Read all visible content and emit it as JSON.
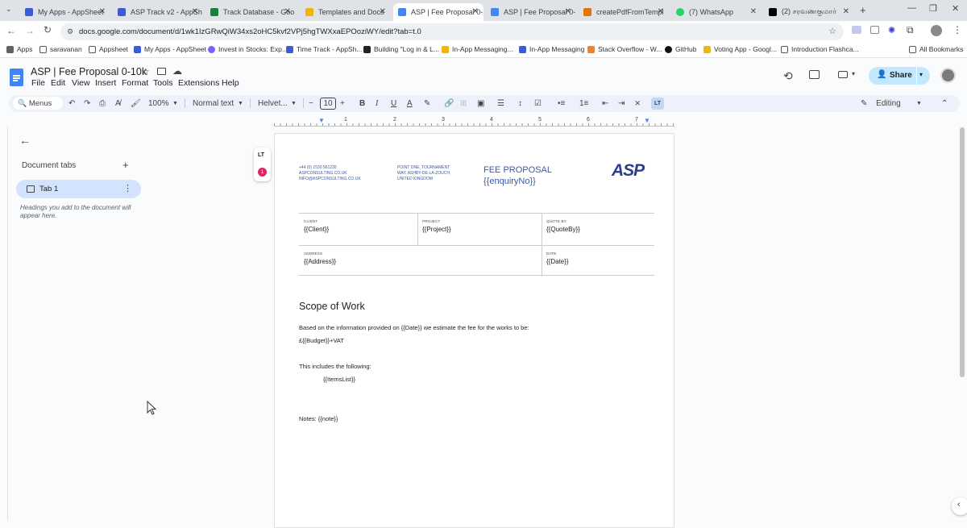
{
  "tabs": [
    {
      "title": "My Apps - AppSheet",
      "color": "#3b5bdb"
    },
    {
      "title": "ASP Track v2 - AppSh",
      "color": "#3b5bdb"
    },
    {
      "title": "Track Database - Goo",
      "color": "#188038"
    },
    {
      "title": "Templates and Docs",
      "color": "#f4b400"
    },
    {
      "title": "ASP | Fee Proposal 0-",
      "color": "#4285f4"
    },
    {
      "title": "ASP | Fee Proposal 0-",
      "color": "#4285f4"
    },
    {
      "title": "createPdfFromTempl",
      "color": "#e37400"
    },
    {
      "title": "(7) WhatsApp",
      "color": "#25d366"
    },
    {
      "title": "(2) சரவணகுமார்",
      "color": "#000000"
    }
  ],
  "url": "docs.google.com/document/d/1wk1IzGRwQiW34xs2oHC5kvf2VPj5hgTWXxaEPOoziWY/edit?tab=t.0",
  "bookmarks": [
    "Apps",
    "saravanan",
    "Appsheet",
    "My Apps - AppSheet",
    "Invest in Stocks: Exp...",
    "Time Track - AppSh...",
    "Building \"Log in & L...",
    "In-App Messaging...",
    "In-App Messaging",
    "Stack Overflow - W...",
    "GitHub",
    "Voting App - Googl...",
    "Introduction Flashca...",
    "All Bookmarks"
  ],
  "doc": {
    "title": "ASP | Fee Proposal 0-10k",
    "menus": [
      "File",
      "Edit",
      "View",
      "Insert",
      "Format",
      "Tools",
      "Extensions",
      "Help"
    ],
    "share": "Share"
  },
  "toolbar": {
    "menus_search": "Menus",
    "zoom": "100%",
    "style": "Normal text",
    "font": "Helvet...",
    "size": "10",
    "mode": "Editing"
  },
  "sidebar": {
    "heading": "Document tabs",
    "tab_label": "Tab 1",
    "hint": "Headings you add to the document will appear here."
  },
  "badge_count": "1",
  "letterhead": {
    "phone": "+44 (0) 1530 561230",
    "web": "ASPCONSULTING.CO.UK",
    "email": "INFO@ASPCONSULTING.CO.UK",
    "addr1": "POINT ONE, TOURNAMENT",
    "addr2": "WAY, ASHBY-DE-LA-ZOUCH,",
    "addr3": "UNITED KINGDOM",
    "title": "FEE PROPOSAL",
    "enquiry": "{{enquiryNo}}",
    "logo": "ASP"
  },
  "table": {
    "client_label": "CLIENT",
    "client": "{{Client}}",
    "project_label": "PROJECT",
    "project": "{{Project}}",
    "quoteby_label": "QUOTE BY",
    "quoteby": "{{QuoteBy}}",
    "address_label": "ADDRESS",
    "address": "{{Address}}",
    "date_label": "DATE",
    "date": "{{Date}}"
  },
  "body": {
    "heading": "Scope of Work",
    "line1": "Based on the information provided on {{Date}} we estimate the fee for the works to be:",
    "line2": "£{{Budget}}+VAT",
    "line3": "This includes the following:",
    "items": "{{ItemsList}}",
    "notes": "Notes: {{note}}"
  },
  "ruler_numbers": [
    "1",
    "2",
    "3",
    "4",
    "5",
    "6",
    "7"
  ]
}
